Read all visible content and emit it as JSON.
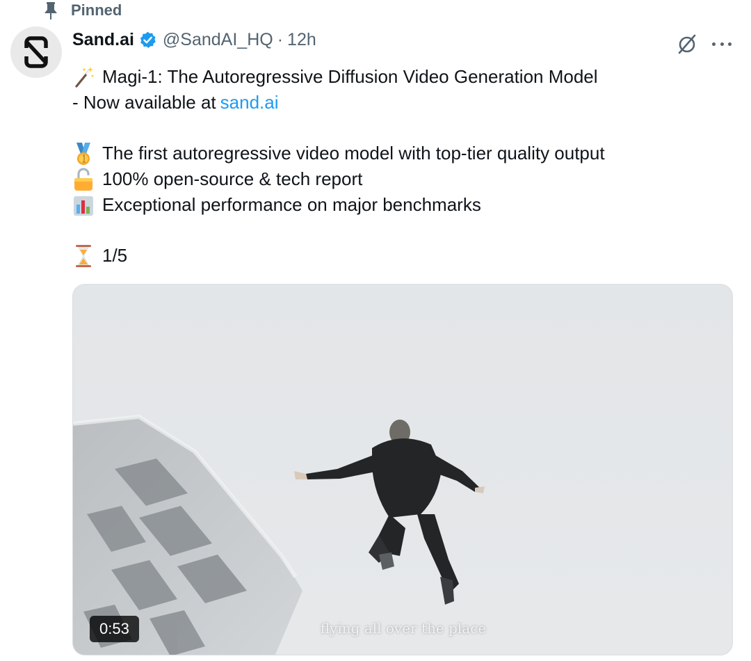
{
  "pinned": {
    "label": "Pinned"
  },
  "author": {
    "display_name": "Sand.ai",
    "handle": "@SandAI_HQ",
    "separator": "·",
    "time": "12h"
  },
  "tweet": {
    "title_line": "Magi-1: The Autoregressive Diffusion Video Generation Model",
    "availability_prefix": "- Now available at",
    "availability_link": "sand.ai",
    "bullets": [
      {
        "icon": "medal-icon",
        "text": "The first autoregressive video model with top-tier quality output"
      },
      {
        "icon": "open-lock-icon",
        "text": "100% open-source & tech report"
      },
      {
        "icon": "bar-chart-icon",
        "text": "Exceptional performance on major benchmarks"
      }
    ],
    "thread_counter": "1/5"
  },
  "media": {
    "duration": "0:53",
    "caption": "flying all over the place"
  },
  "colors": {
    "text": "#0f1419",
    "secondary": "#536471",
    "link": "#1d9bf0",
    "verified": "#1d9bf0"
  }
}
